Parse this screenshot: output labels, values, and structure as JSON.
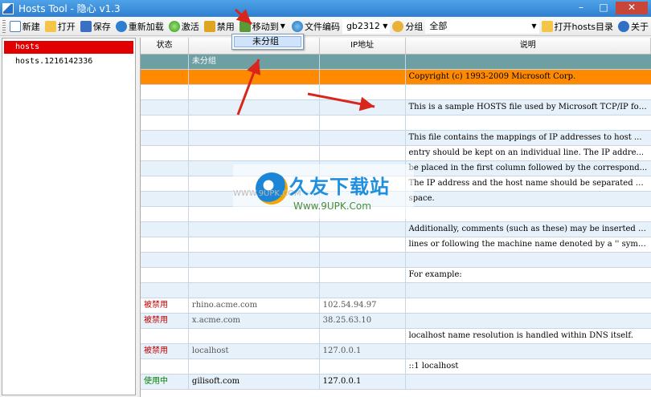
{
  "window": {
    "title": "Hosts Tool - 隐心 v1.3",
    "minimize": "–",
    "maximize": "□",
    "close": "✕"
  },
  "toolbar": {
    "new": "新建",
    "open": "打开",
    "save": "保存",
    "reload": "重新加载",
    "activate": "激活",
    "disable": "禁用",
    "move_to": "移动到",
    "encoding": "文件编码",
    "encoding_value": "gb2312",
    "group_label": "分组",
    "group_value": "全部",
    "open_hosts_dir": "打开hosts目录",
    "about": "关于",
    "icons": {
      "new": "new-file-icon",
      "open": "folder-icon",
      "save": "floppy-icon",
      "reload": "reload-icon",
      "activate": "green-dot-icon",
      "disable": "lock-icon",
      "move_to": "move-icon",
      "encoding": "globe-icon",
      "group": "group-icon",
      "open_hosts_dir": "folder-icon",
      "about": "help-icon"
    }
  },
  "popup": {
    "item": "未分组"
  },
  "tree": {
    "items": [
      "hosts",
      "hosts.1216142336"
    ]
  },
  "grid": {
    "headers": [
      "状态",
      "",
      "IP地址",
      "说明"
    ],
    "rows": [
      {
        "type": "group",
        "c0": "",
        "c1": "未分组",
        "c2": "",
        "c3": ""
      },
      {
        "type": "hl",
        "c0": "",
        "c1": "",
        "c2": "",
        "c3": "Copyright (c) 1993-2009 Microsoft Corp."
      },
      {
        "type": "plain",
        "c0": "",
        "c1": "",
        "c2": "",
        "c3": ""
      },
      {
        "type": "alt",
        "c0": "",
        "c1": "",
        "c2": "",
        "c3": "This is a sample HOSTS file used by Microsoft TCP/IP for..."
      },
      {
        "type": "plain",
        "c0": "",
        "c1": "",
        "c2": "",
        "c3": ""
      },
      {
        "type": "alt",
        "c0": "",
        "c1": "",
        "c2": "",
        "c3": "This file contains the mappings of IP addresses to host ..."
      },
      {
        "type": "plain",
        "c0": "",
        "c1": "",
        "c2": "",
        "c3": "entry should be kept on an individual line. The IP addre..."
      },
      {
        "type": "alt",
        "c0": "",
        "c1": "",
        "c2": "",
        "c3": "be placed in the first column followed by the correspond..."
      },
      {
        "type": "plain",
        "c0": "",
        "c1": "",
        "c2": "",
        "c3": "The IP address and the host name should be separated by ..."
      },
      {
        "type": "alt",
        "c0": "",
        "c1": "",
        "c2": "",
        "c3": "space."
      },
      {
        "type": "plain",
        "c0": "",
        "c1": "",
        "c2": "",
        "c3": ""
      },
      {
        "type": "alt",
        "c0": "",
        "c1": "",
        "c2": "",
        "c3": "Additionally, comments (such as these) may be inserted o..."
      },
      {
        "type": "plain",
        "c0": "",
        "c1": "",
        "c2": "",
        "c3": "lines or following the machine name denoted by a '' symbol."
      },
      {
        "type": "alt",
        "c0": "",
        "c1": "",
        "c2": "",
        "c3": ""
      },
      {
        "type": "plain",
        "c0": "",
        "c1": "",
        "c2": "",
        "c3": "For example:"
      },
      {
        "type": "alt",
        "c0": "",
        "c1": "",
        "c2": "",
        "c3": ""
      },
      {
        "type": "plain",
        "c0": "被禁用",
        "status": "disabled",
        "c1": "rhino.acme.com",
        "c2": "102.54.94.97",
        "c3": ""
      },
      {
        "type": "alt",
        "c0": "被禁用",
        "status": "disabled",
        "c1": "x.acme.com",
        "c2": "38.25.63.10",
        "c3": ""
      },
      {
        "type": "plain",
        "c0": "",
        "c1": "",
        "c2": "",
        "c3": "localhost name resolution is handled within DNS itself."
      },
      {
        "type": "alt",
        "c0": "被禁用",
        "status": "disabled",
        "c1": "localhost",
        "c2": "127.0.0.1",
        "c3": ""
      },
      {
        "type": "plain",
        "c0": "",
        "c1": "",
        "c2": "",
        "c3": "::1 localhost"
      },
      {
        "type": "alt",
        "c0": "使用中",
        "status": "enabled",
        "c1": "gilisoft.com",
        "c2": "127.0.0.1",
        "c3": ""
      }
    ]
  },
  "watermark": {
    "title": "久友下载站",
    "url": "Www.9UPK.Com",
    "small": "WWW.9UPK.COM"
  },
  "colors": {
    "group_row": "#6e9fa3",
    "highlight_row": "#ff8a00",
    "selected_tree": "#e00000",
    "disabled": "#c00000",
    "enabled": "#008000",
    "arrow": "#d9261c"
  }
}
